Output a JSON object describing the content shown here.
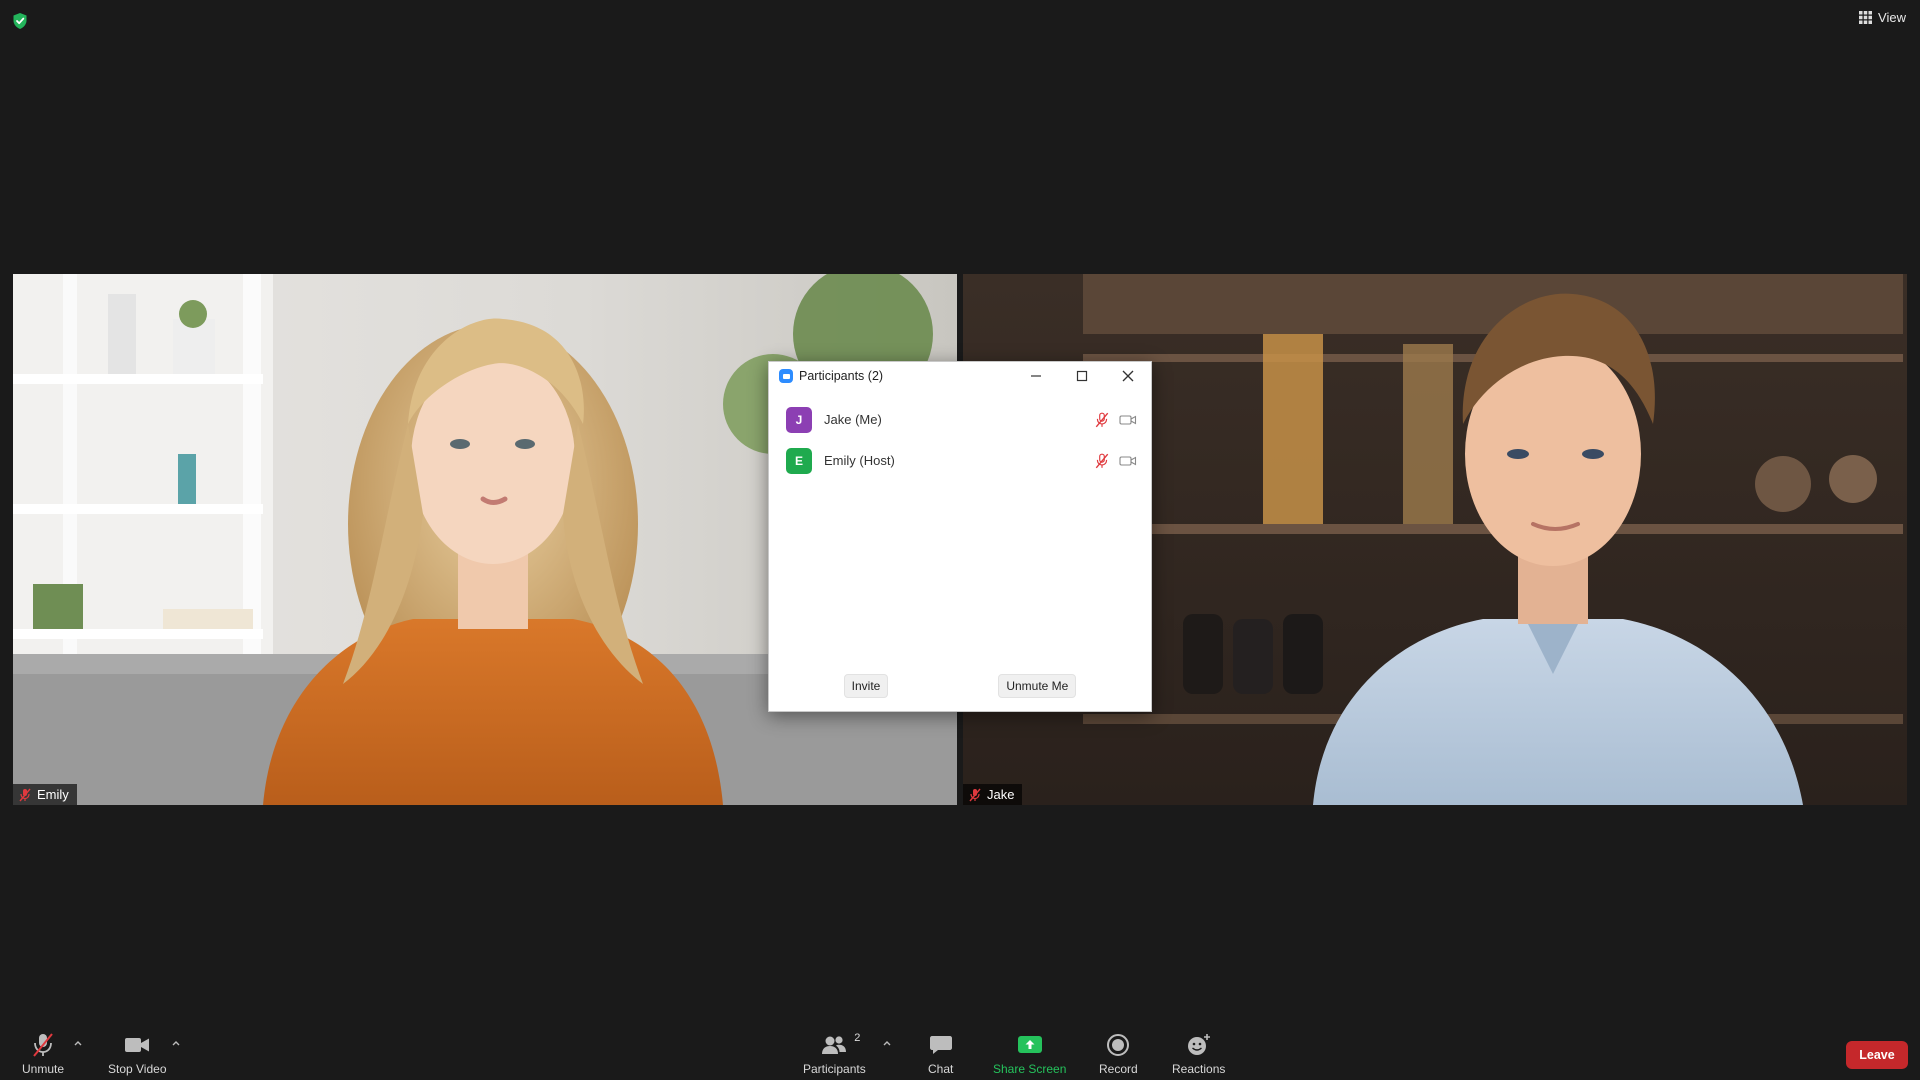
{
  "topbar": {
    "view_label": "View"
  },
  "tiles": [
    {
      "name": "Emily",
      "muted": true
    },
    {
      "name": "Jake",
      "muted": true
    }
  ],
  "participants_window": {
    "title": "Participants (2)",
    "participants": [
      {
        "initial": "J",
        "name": "Jake (Me)",
        "avatar_color": "#8c3fb3"
      },
      {
        "initial": "E",
        "name": "Emily (Host)",
        "avatar_color": "#1faa4e"
      }
    ],
    "invite_label": "Invite",
    "unmute_me_label": "Unmute Me"
  },
  "toolbar": {
    "unmute_label": "Unmute",
    "stop_video_label": "Stop Video",
    "participants_label": "Participants",
    "participants_count": "2",
    "chat_label": "Chat",
    "share_screen_label": "Share Screen",
    "record_label": "Record",
    "reactions_label": "Reactions",
    "leave_label": "Leave"
  },
  "colors": {
    "background": "#1a1a1a",
    "muted_red": "#e0393e",
    "share_green": "#25c25c",
    "leave_red": "#c5282b",
    "zoom_blue": "#2d8cff"
  }
}
